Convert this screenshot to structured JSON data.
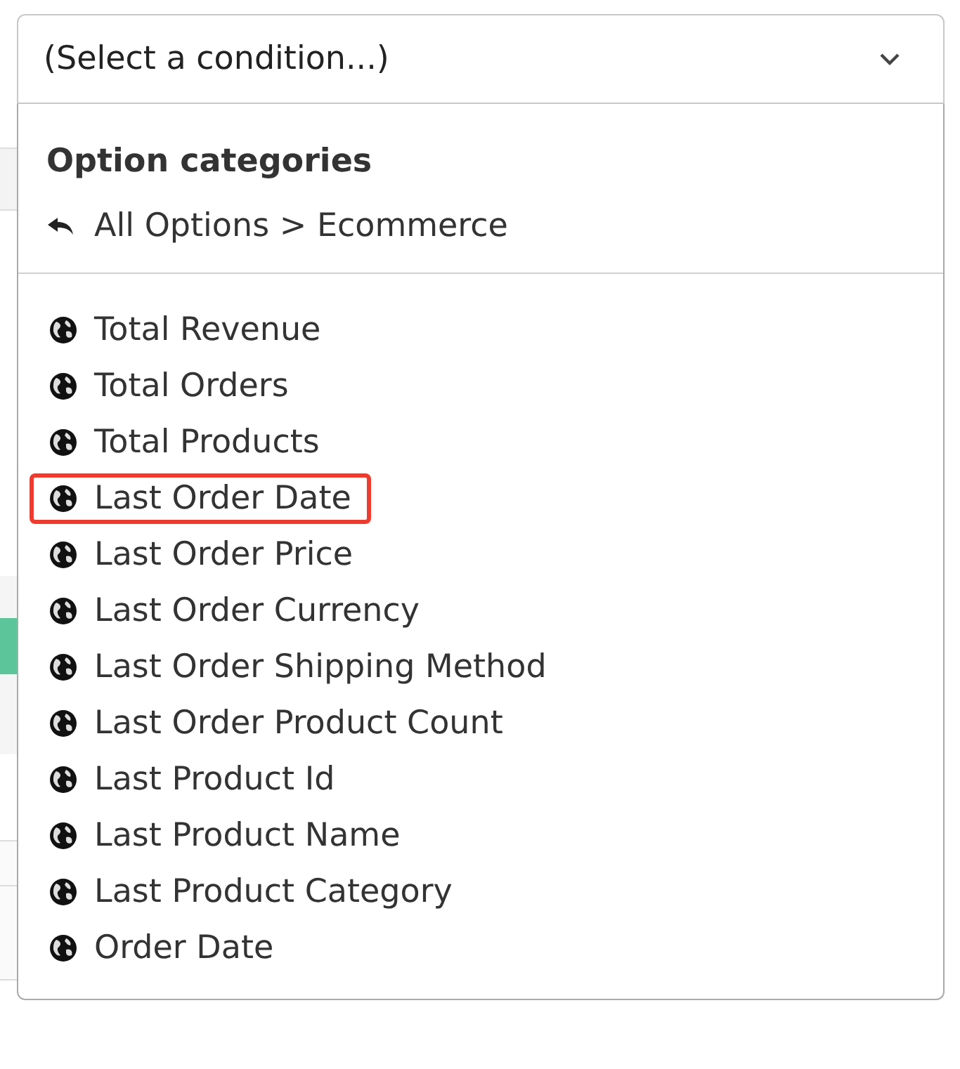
{
  "select": {
    "value": "(Select a condition...)",
    "expanded": true
  },
  "menu": {
    "heading": "Option categories",
    "breadcrumb": "All Options > Ecommerce",
    "items": [
      {
        "label": "Total Revenue",
        "highlighted": false
      },
      {
        "label": "Total Orders",
        "highlighted": false
      },
      {
        "label": "Total Products",
        "highlighted": false
      },
      {
        "label": "Last Order Date",
        "highlighted": true
      },
      {
        "label": "Last Order Price",
        "highlighted": false
      },
      {
        "label": "Last Order Currency",
        "highlighted": false
      },
      {
        "label": "Last Order Shipping Method",
        "highlighted": false
      },
      {
        "label": "Last Order Product Count",
        "highlighted": false
      },
      {
        "label": "Last Product Id",
        "highlighted": false
      },
      {
        "label": "Last Product Name",
        "highlighted": false
      },
      {
        "label": "Last Product Category",
        "highlighted": false
      },
      {
        "label": "Order Date",
        "highlighted": false
      }
    ]
  }
}
